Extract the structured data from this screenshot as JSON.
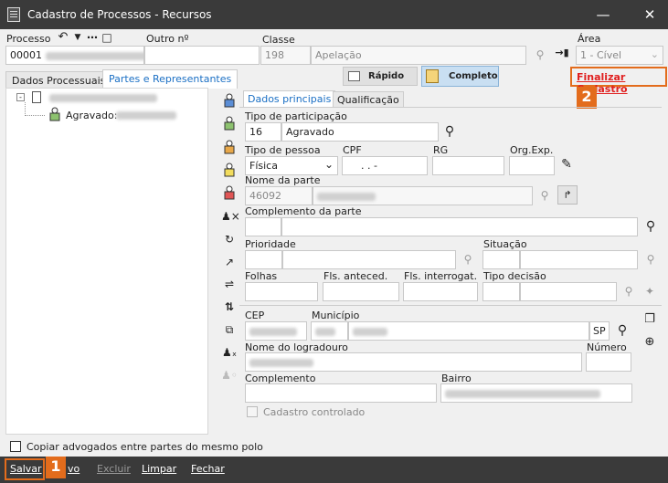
{
  "window": {
    "title": "Cadastro de Processos - Recursos"
  },
  "header": {
    "processo_label": "Processo",
    "processo_value": "00001",
    "outro_label": "Outro nº",
    "classe_label": "Classe",
    "classe_code": "198",
    "classe_name": "Apelação",
    "area_label": "Área",
    "area_value": "1 - Cível"
  },
  "tabs": {
    "dados": "Dados Processuais",
    "partes": "Partes e Representantes"
  },
  "modes": {
    "rapido": "Rápido",
    "completo": "Completo"
  },
  "finalizar": "Finalizar Cadastro",
  "tree": {
    "child_label": "Agravado:"
  },
  "subtabs": {
    "principais": "Dados principais",
    "qualificacao": "Qualificação"
  },
  "form": {
    "tipo_participacao_label": "Tipo de participação",
    "tipo_participacao_code": "16",
    "tipo_participacao_name": "Agravado",
    "tipo_pessoa_label": "Tipo de pessoa",
    "tipo_pessoa_value": "Física",
    "cpf_label": "CPF",
    "cpf_value": ". . -",
    "rg_label": "RG",
    "orgexp_label": "Org.Exp.",
    "nome_parte_label": "Nome da parte",
    "nome_parte_code": "46092",
    "complemento_parte_label": "Complemento da parte",
    "prioridade_label": "Prioridade",
    "situacao_label": "Situação",
    "folhas_label": "Folhas",
    "fls_anteced_label": "Fls. anteced.",
    "fls_interrogat_label": "Fls. interrogat.",
    "tipo_decisao_label": "Tipo decisão",
    "cep_label": "CEP",
    "municipio_label": "Município",
    "uf_value": "SP",
    "logradouro_label": "Nome do logradouro",
    "numero_label": "Número",
    "complemento_label": "Complemento",
    "bairro_label": "Bairro",
    "cadastro_controlado_label": "Cadastro controlado"
  },
  "copiar_label": "Copiar advogados entre partes do mesmo polo",
  "bottom": {
    "salvar": "Salvar",
    "novo": "vo",
    "excluir": "Excluir",
    "limpar": "Limpar",
    "fechar": "Fechar"
  },
  "badges": {
    "one": "1",
    "two": "2"
  },
  "colors": {
    "accent": "#e36c1c",
    "link_red": "#e02020",
    "titlebar": "#3a3a3a",
    "tab_blue": "#1a6fc4"
  }
}
